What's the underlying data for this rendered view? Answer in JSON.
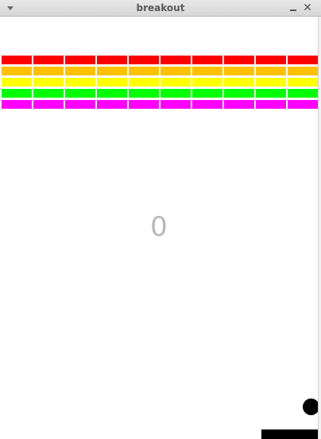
{
  "window": {
    "title": "breakout",
    "close_glyph": "✕"
  },
  "game": {
    "score": "0",
    "brick_rows": [
      {
        "color": "#ff0000",
        "count": 10
      },
      {
        "color": "#ffc000",
        "count": 10
      },
      {
        "color": "#ffff00",
        "count": 10
      },
      {
        "color": "#00ff00",
        "count": 10
      },
      {
        "color": "#ff00ff",
        "count": 10
      }
    ],
    "ball_color": "#000000",
    "paddle_color": "#000000"
  },
  "icons": {
    "menu": "chevron-down-icon",
    "minimize": "minimize-icon",
    "close": "close-icon"
  }
}
